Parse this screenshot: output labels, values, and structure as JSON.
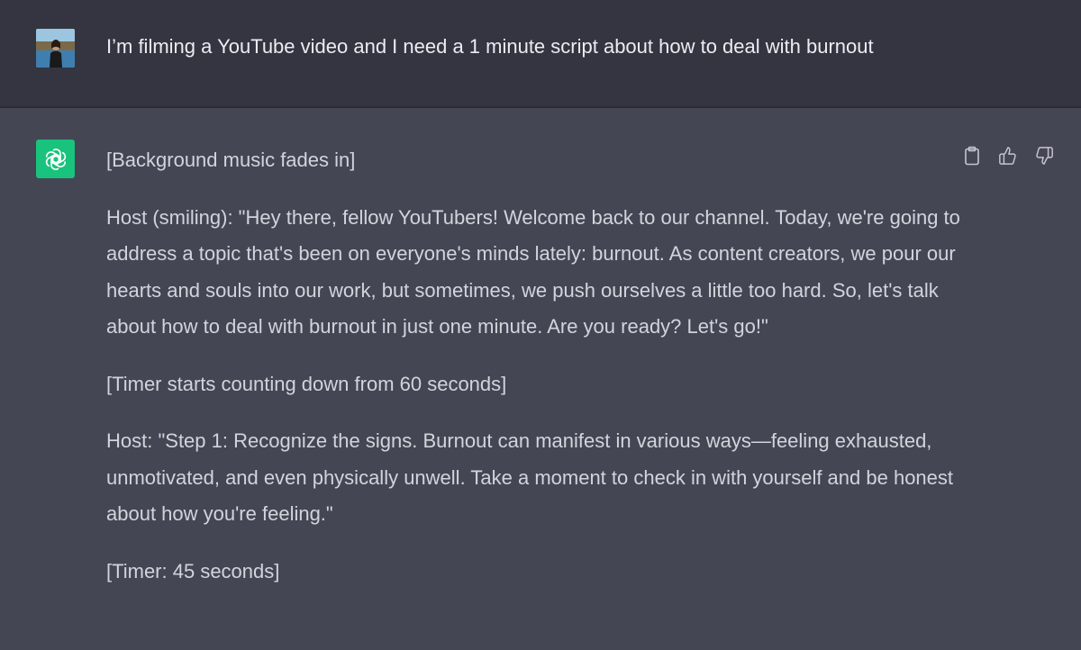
{
  "user_message": {
    "text": "I’m filming a YouTube video and I need a 1 minute script about how to deal with burnout",
    "avatar": "user-avatar-photo"
  },
  "assistant_message": {
    "avatar": "openai-logo-icon",
    "avatar_color": "#19c37d",
    "paragraphs": [
      "[Background music fades in]",
      "Host (smiling): \"Hey there, fellow YouTubers! Welcome back to our channel. Today, we're going to address a topic that's been on everyone's minds lately: burnout. As content creators, we pour our hearts and souls into our work, but sometimes, we push ourselves a little too hard. So, let's talk about how to deal with burnout in just one minute. Are you ready? Let's go!\"",
      "[Timer starts counting down from 60 seconds]",
      "Host: \"Step 1: Recognize the signs. Burnout can manifest in various ways—feeling exhausted, unmotivated, and even physically unwell. Take a moment to check in with yourself and be honest about how you're feeling.\"",
      "[Timer: 45 seconds]"
    ],
    "actions": [
      "clipboard-icon",
      "thumbs-up-icon",
      "thumbs-down-icon"
    ]
  },
  "colors": {
    "user_bg": "#343541",
    "assistant_bg": "#444654",
    "text": "#d1d5db",
    "accent": "#19c37d"
  }
}
